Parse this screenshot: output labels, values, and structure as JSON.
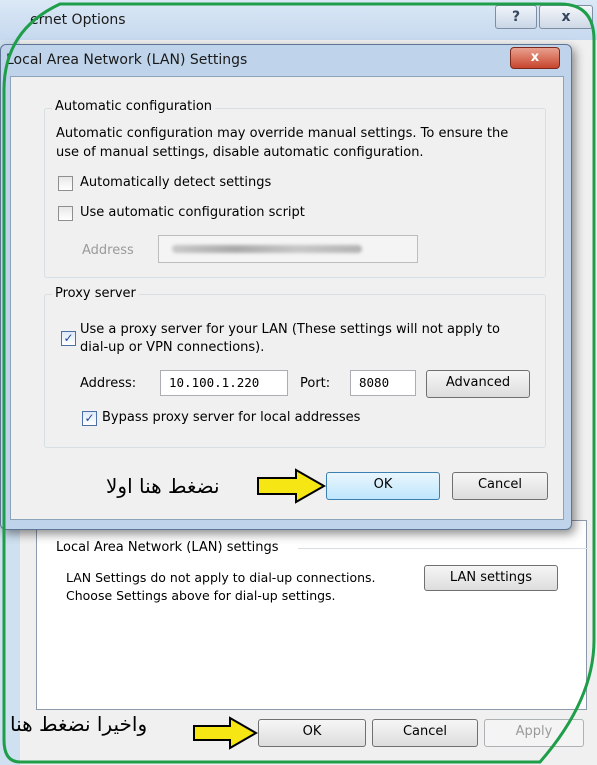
{
  "internet_options": {
    "title": "ernet Options",
    "help_label": "?",
    "close_label": "x",
    "lan_section": {
      "group_label": "Local Area Network (LAN) settings",
      "description_line_1": "LAN Settings do not apply to dial-up connections.",
      "description_line_2": "Choose Settings above for dial-up settings.",
      "lan_settings_button": "LAN settings"
    },
    "buttons": {
      "ok": "OK",
      "cancel": "Cancel",
      "apply": "Apply"
    }
  },
  "lan_dialog": {
    "title": "Local Area Network (LAN) Settings",
    "close_label": "x",
    "automatic_configuration": {
      "group_label": "Automatic configuration",
      "description_line_1": "Automatic configuration may override manual settings.  To ensure the",
      "description_line_2": "use of manual settings, disable automatic configuration.",
      "auto_detect": {
        "label": "Automatically detect settings",
        "checked": false
      },
      "use_script": {
        "label": "Use automatic configuration script",
        "checked": false
      },
      "address_label": "Address"
    },
    "proxy_server": {
      "group_label": "Proxy server",
      "use_proxy_line_1": "Use a proxy server for your LAN (These settings will not apply to",
      "use_proxy_line_2": "dial-up or VPN connections).",
      "use_proxy_checked": true,
      "address_label": "Address:",
      "address_value": "10.100.1.220",
      "port_label": "Port:",
      "port_value": "8080",
      "advanced_button": "Advanced",
      "bypass": {
        "label": "Bypass proxy server for local addresses",
        "checked": true
      }
    },
    "buttons": {
      "ok": "OK",
      "cancel": "Cancel"
    }
  },
  "annotations": {
    "click_first": "نضغط هنا اولا",
    "click_last": "واخيرا نضغط هنا",
    "arrow_color": "#f5e614",
    "frame_color": "#1f9e4a"
  },
  "colors": {
    "focus_button": "#bee6fd",
    "close_red": "#c7452d",
    "checkmark": "#224a9a"
  }
}
